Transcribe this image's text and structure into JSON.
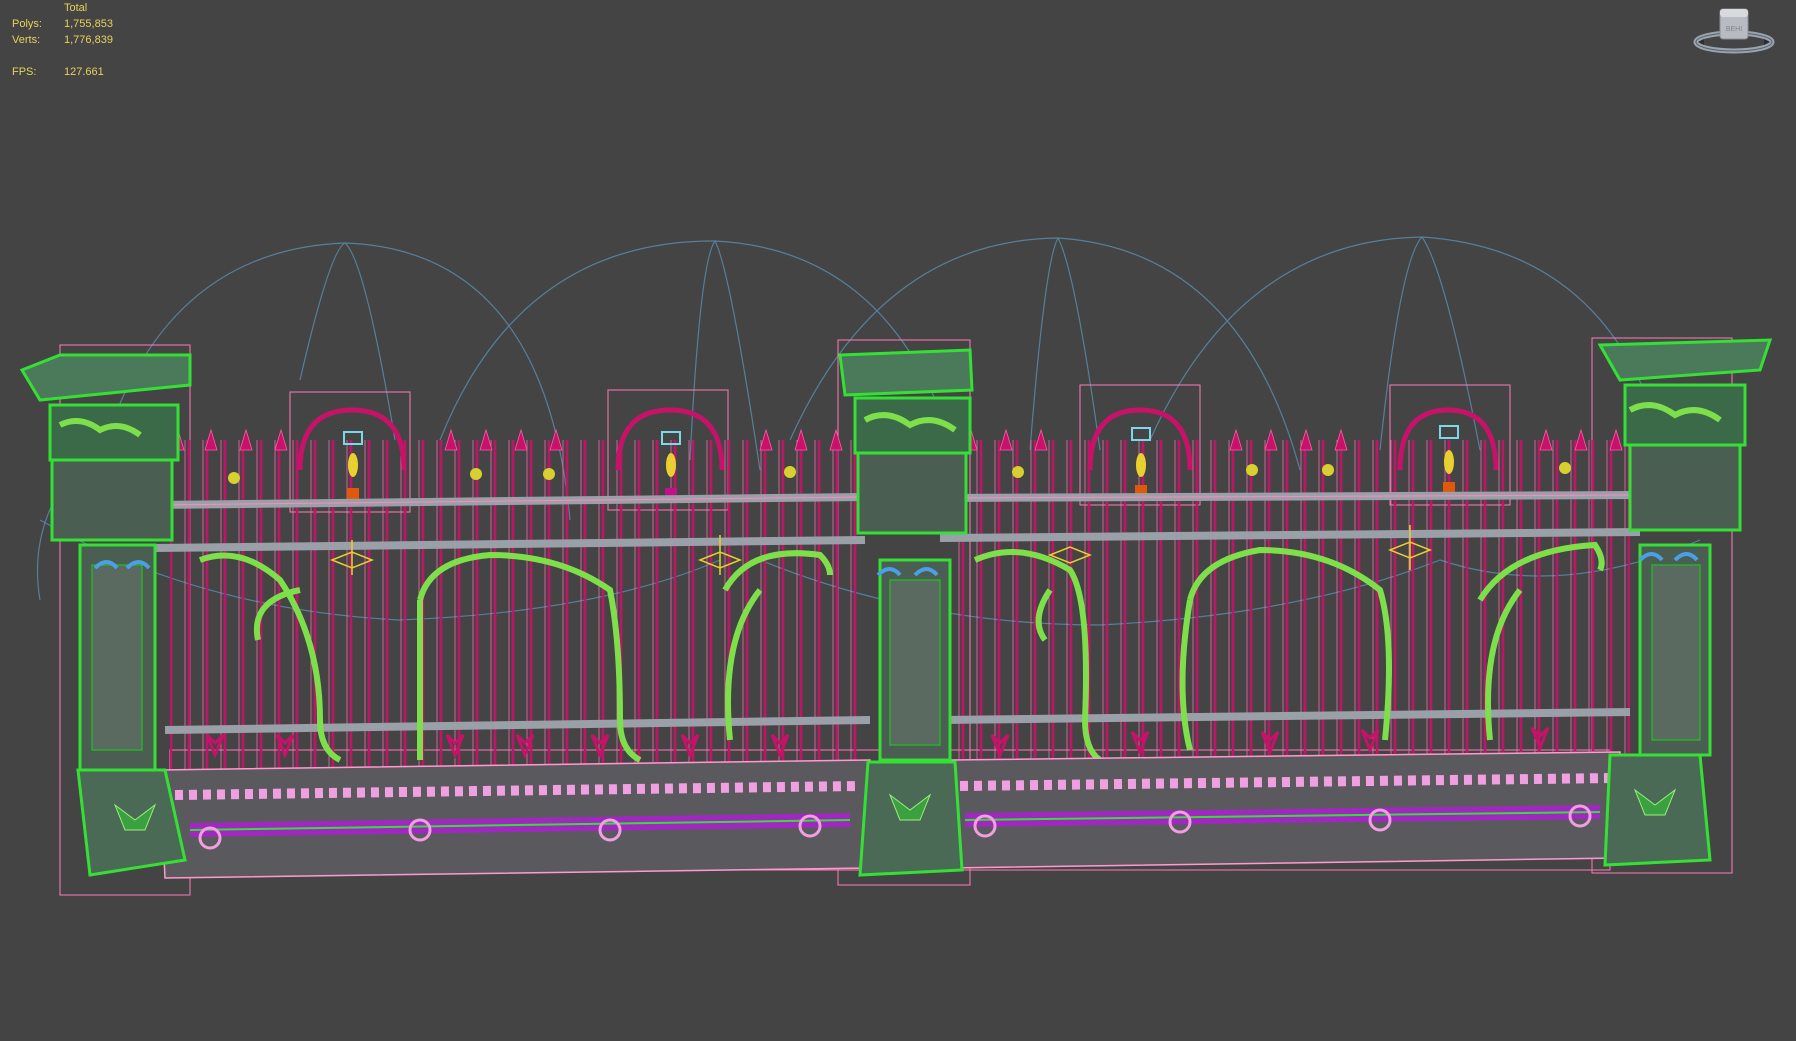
{
  "stats": {
    "header": "Total",
    "polys_label": "Polys:",
    "polys_value": "1,755,853",
    "verts_label": "Verts:",
    "verts_value": "1,776,839",
    "fps_label": "FPS:",
    "fps_value": "127.661"
  },
  "viewcube": {
    "face_label": "BEHI",
    "icon": "viewcube-icon"
  },
  "colors": {
    "background": "#444444",
    "stats_text": "#e8d25a",
    "pillar_wire": "#35e035",
    "pillar_fill": "#3a5e46",
    "bar_wire": "#c8126a",
    "scroll_wire": "#7de04a",
    "rail": "#9aa0a8",
    "bbox": "#ff7ab8",
    "light_gizmo": "#5a8aa8",
    "accent_blue": "#4aa0e8",
    "accent_yellow": "#e8d030",
    "base_pink": "#f0a0e0",
    "base_purple": "#a028c0"
  }
}
